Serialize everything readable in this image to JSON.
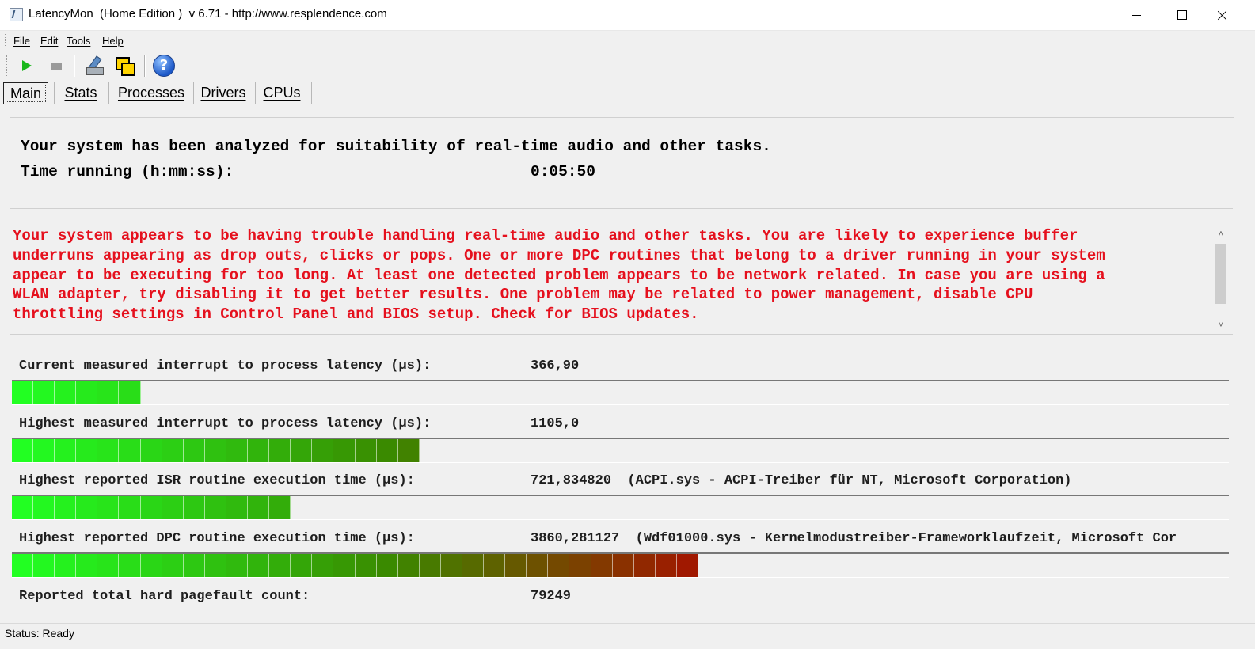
{
  "window": {
    "title": "LatencyMon  (Home Edition )  v 6.71 - http://www.resplendence.com"
  },
  "menu": {
    "items": [
      {
        "label": "File"
      },
      {
        "label": "Edit"
      },
      {
        "label": "Tools"
      },
      {
        "label": "Help"
      }
    ]
  },
  "toolbar": {
    "buttons": [
      {
        "icon": "play-icon",
        "color": "#19b81b"
      },
      {
        "icon": "stop-icon"
      },
      {
        "icon": "analyze-tool-icon"
      },
      {
        "icon": "windows-icon"
      },
      {
        "icon": "help-icon",
        "glyph": "?"
      }
    ]
  },
  "tabs": [
    {
      "label": "Main",
      "active": true
    },
    {
      "label": "Stats"
    },
    {
      "label": "Processes"
    },
    {
      "label": "Drivers"
    },
    {
      "label": "CPUs"
    }
  ],
  "summary": {
    "analysis_text": "Your system has been analyzed for suitability of real-time audio and other tasks.",
    "time_label": "Time running (h:mm:ss):",
    "time_value": "0:05:50"
  },
  "warning": {
    "color": "#e5101d",
    "text": "Your system appears to be having trouble handling real-time audio and other tasks. You are likely to experience buffer\nunderruns appearing as drop outs, clicks or pops. One or more DPC routines that belong to a driver running in your system\nappear to be executing for too long. At least one detected problem appears to be network related. In case you are using a\nWLAN adapter, try disabling it to get better results. One problem may be related to power management, disable CPU\nthrottling settings in Control Panel and BIOS setup. Check for BIOS updates."
  },
  "metrics": [
    {
      "label": "Current measured interrupt to process latency (µs):",
      "value": "366,90",
      "segments": 6
    },
    {
      "label": "Highest measured interrupt to process latency (µs):",
      "value": "1105,0",
      "segments": 19
    },
    {
      "label": "Highest reported ISR routine execution time (µs):",
      "value": "721,834820  (ACPI.sys - ACPI-Treiber für NT, Microsoft Corporation)",
      "segments": 13
    },
    {
      "label": "Highest reported DPC routine execution time (µs):",
      "value": "3860,281127  (Wdf01000.sys - Kernelmodustreiber-Frameworklaufzeit, Microsoft Cor",
      "segments": 32
    },
    {
      "label": "Reported total hard pagefault count:",
      "value": "79249"
    }
  ],
  "bar_colors": {
    "low": "#22ff22",
    "mid": "#3a8a00",
    "high": "#a01800"
  },
  "status": {
    "text": "Status: Ready"
  }
}
